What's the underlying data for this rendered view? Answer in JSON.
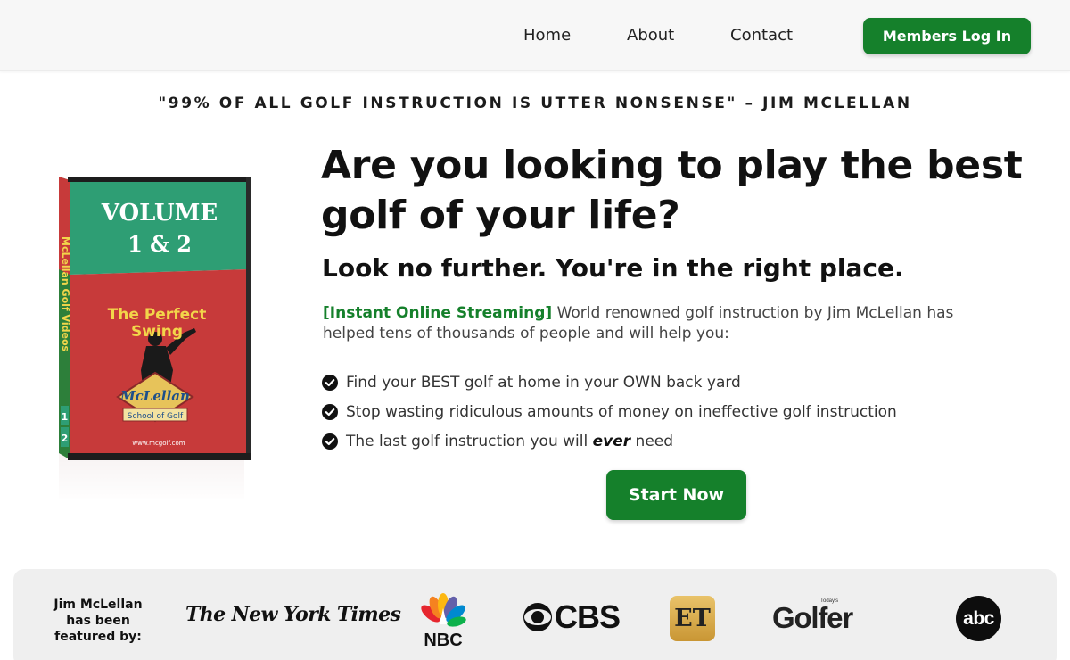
{
  "nav": {
    "links": [
      {
        "label": "Home"
      },
      {
        "label": "About"
      },
      {
        "label": "Contact"
      }
    ],
    "login_label": "Members Log In"
  },
  "quote": "\"99% OF ALL GOLF INSTRUCTION IS UTTER NONSENSE\" – JIM MCLELLAN",
  "product": {
    "volume": "VOLUME",
    "volume_num": "1 & 2",
    "spine_text": "McLellan Golf Videos",
    "title_line1": "The Perfect",
    "title_line2": "Swing",
    "badge_line1": "McLellan",
    "badge_line2": "School of Golf",
    "url": "www.mcgolf.com",
    "spine_nums": [
      "1",
      "2"
    ],
    "colors": {
      "top": "#2e9e74",
      "bottom": "#c73a3a",
      "spine": "#2d7f3a",
      "badge": "#e7c35a"
    }
  },
  "hero": {
    "headline": "Are you looking to play the best golf of your life?",
    "subhead": "Look no further. You're in the right place.",
    "intro_tag": "[Instant Online Streaming]",
    "intro_text": " World renowned golf instruction by Jim McLellan has helped tens of thousands of people and will help you:",
    "bullets": [
      {
        "text": "Find your BEST golf at home in your OWN back yard"
      },
      {
        "text": "Stop wasting ridiculous amounts of money on ineffective golf instruction"
      },
      {
        "pre": "The last golf instruction you will ",
        "em": "ever",
        "post": " need"
      }
    ],
    "cta": "Start Now"
  },
  "featured": {
    "label_lines": [
      "Jim McLellan",
      "has been",
      "featured by:"
    ],
    "logos": {
      "nyt": "The New York Times",
      "nbc": "NBC",
      "cbs": "CBS",
      "et": "ET",
      "golfer_small": "Today's",
      "golfer": "Golfer",
      "abc": "abc"
    }
  },
  "colors": {
    "accent": "#15802b",
    "nav_bg": "#f7f7f7",
    "featured_bg": "#efefef"
  }
}
